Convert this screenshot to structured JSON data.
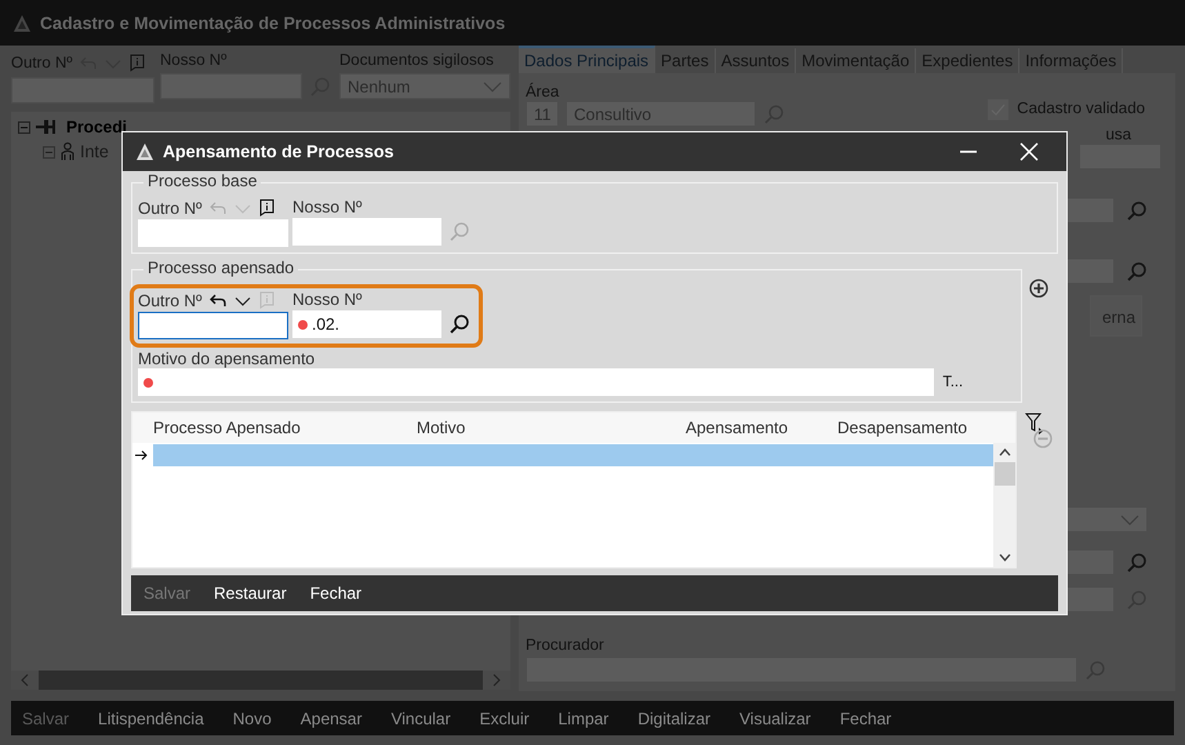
{
  "main_window": {
    "title": "Cadastro e Movimentação de Processos Administrativos",
    "header": {
      "outro_label": "Outro Nº",
      "nosso_label": "Nosso Nº",
      "sigilo_label": "Documentos sigilosos",
      "sigilo_value": "Nenhum"
    },
    "tree": [
      {
        "label": "Procedi",
        "expanded": true,
        "children": [
          {
            "label": "Inte",
            "expanded": true
          }
        ]
      }
    ],
    "tabs": [
      {
        "label": "Dados Principais",
        "selected": true
      },
      {
        "label": "Partes",
        "selected": false
      },
      {
        "label": "Assuntos",
        "selected": false
      },
      {
        "label": "Movimentação",
        "selected": false
      },
      {
        "label": "Expedientes",
        "selected": false
      },
      {
        "label": "Informações",
        "selected": false
      }
    ],
    "area": {
      "label": "Área",
      "code": "11",
      "value": "Consultivo"
    },
    "cadastro_validado": {
      "label": "Cadastro validado",
      "checked": true
    },
    "causa_label_fragment": "usa",
    "button_fragment": "erna",
    "procurador_label": "Procurador",
    "toolbar": [
      {
        "label": "Salvar",
        "disabled": true
      },
      {
        "label": "Litispendência",
        "disabled": false
      },
      {
        "label": "Novo",
        "disabled": false
      },
      {
        "label": "Apensar",
        "disabled": false
      },
      {
        "label": "Vincular",
        "disabled": false
      },
      {
        "label": "Excluir",
        "disabled": false
      },
      {
        "label": "Limpar",
        "disabled": false
      },
      {
        "label": "Digitalizar",
        "disabled": false
      },
      {
        "label": "Visualizar",
        "disabled": false
      },
      {
        "label": "Fechar",
        "disabled": false
      }
    ]
  },
  "dialog": {
    "title": "Apensamento de Processos",
    "base": {
      "legend": "Processo base",
      "outro_label": "Outro Nº",
      "nosso_label": "Nosso Nº"
    },
    "apensado": {
      "legend": "Processo apensado",
      "highlighted": true,
      "outro_label": "Outro Nº",
      "outro_focused": true,
      "nosso_label": "Nosso Nº",
      "nosso_value": ".02.",
      "nosso_required": true,
      "motivo_label": "Motivo do apensamento",
      "motivo_required": true,
      "text_button": "T..."
    },
    "table": {
      "columns": [
        "Processo Apensado",
        "Motivo",
        "Apensamento",
        "Desapensamento"
      ],
      "rows": [
        {
          "selected": true
        }
      ]
    },
    "buttons": [
      {
        "label": "Salvar",
        "disabled": true
      },
      {
        "label": "Restaurar",
        "disabled": false
      },
      {
        "label": "Fechar",
        "disabled": false
      }
    ]
  }
}
